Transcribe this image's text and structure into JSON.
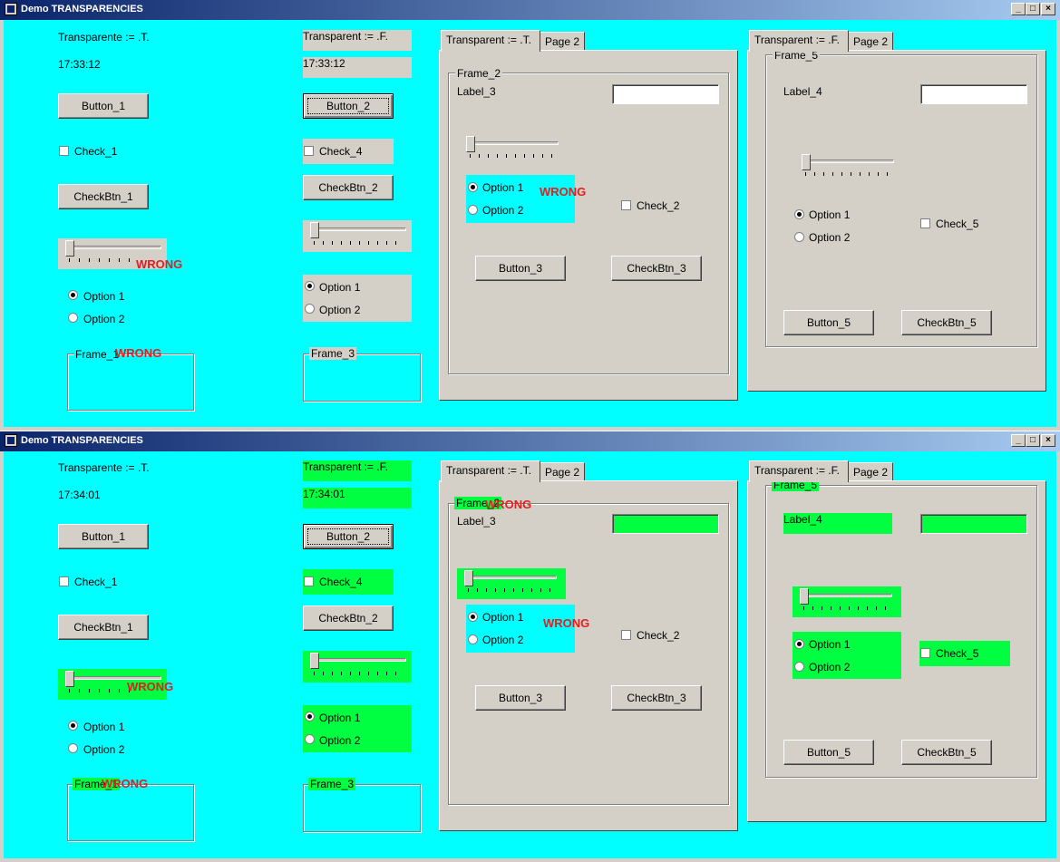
{
  "colors": {
    "client_bg": "#00ffff",
    "grey": "#d4d0c8",
    "green": "#00ff40",
    "wrong": "#e02020"
  },
  "windows": [
    {
      "title": "Demo TRANSPARENCIES",
      "col1": {
        "label": "Transparente := .T.",
        "time": "17:33:12",
        "button": "Button_1",
        "check": "Check_1",
        "checkbtn": "CheckBtn_1",
        "wrong_slider": "WRONG",
        "opt1": "Option 1",
        "opt2": "Option 2",
        "frame": "Frame_1",
        "wrong_frame": "WRONG"
      },
      "col2": {
        "label": "Transparent := .F.",
        "time": "17:33:12",
        "button": "Button_2",
        "check": "Check_4",
        "checkbtn": "CheckBtn_2",
        "opt1": "Option 1",
        "opt2": "Option 2",
        "frame": "Frame_3"
      },
      "tabs1": {
        "tab_active": "Transparent := .T.",
        "tab2": "Page 2",
        "frame": "Frame_2",
        "label": "Label_3",
        "opt1": "Option 1",
        "opt2": "Option 2",
        "wrong_radio": "WRONG",
        "check": "Check_2",
        "button": "Button_3",
        "checkbtn": "CheckBtn_3"
      },
      "tabs2": {
        "tab_active": "Transparent := .F.",
        "tab2": "Page 2",
        "frame": "Frame_5",
        "label": "Label_4",
        "opt1": "Option 1",
        "opt2": "Option 2",
        "check": "Check_5",
        "button": "Button_5",
        "checkbtn": "CheckBtn_5"
      }
    },
    {
      "title": "Demo TRANSPARENCIES",
      "col1": {
        "label": "Transparente := .T.",
        "time": "17:34:01",
        "button": "Button_1",
        "check": "Check_1",
        "checkbtn": "CheckBtn_1",
        "wrong_slider": "WRONG",
        "opt1": "Option 1",
        "opt2": "Option 2",
        "frame": "Frame_1",
        "wrong_frame": "WRONG"
      },
      "col2": {
        "label": "Transparent := .F.",
        "time": "17:34:01",
        "button": "Button_2",
        "check": "Check_4",
        "checkbtn": "CheckBtn_2",
        "opt1": "Option 1",
        "opt2": "Option 2",
        "frame": "Frame_3"
      },
      "tabs1": {
        "tab_active": "Transparent := .T.",
        "tab2": "Page 2",
        "frame": "Frame_2",
        "wrong_frame": "WRONG",
        "label": "Label_3",
        "opt1": "Option 1",
        "opt2": "Option 2",
        "wrong_radio": "WRONG",
        "check": "Check_2",
        "button": "Button_3",
        "checkbtn": "CheckBtn_3"
      },
      "tabs2": {
        "tab_active": "Transparent := .F.",
        "tab2": "Page 2",
        "frame": "Frame_5",
        "label": "Label_4",
        "opt1": "Option 1",
        "opt2": "Option 2",
        "check": "Check_5",
        "button": "Button_5",
        "checkbtn": "CheckBtn_5"
      }
    }
  ]
}
